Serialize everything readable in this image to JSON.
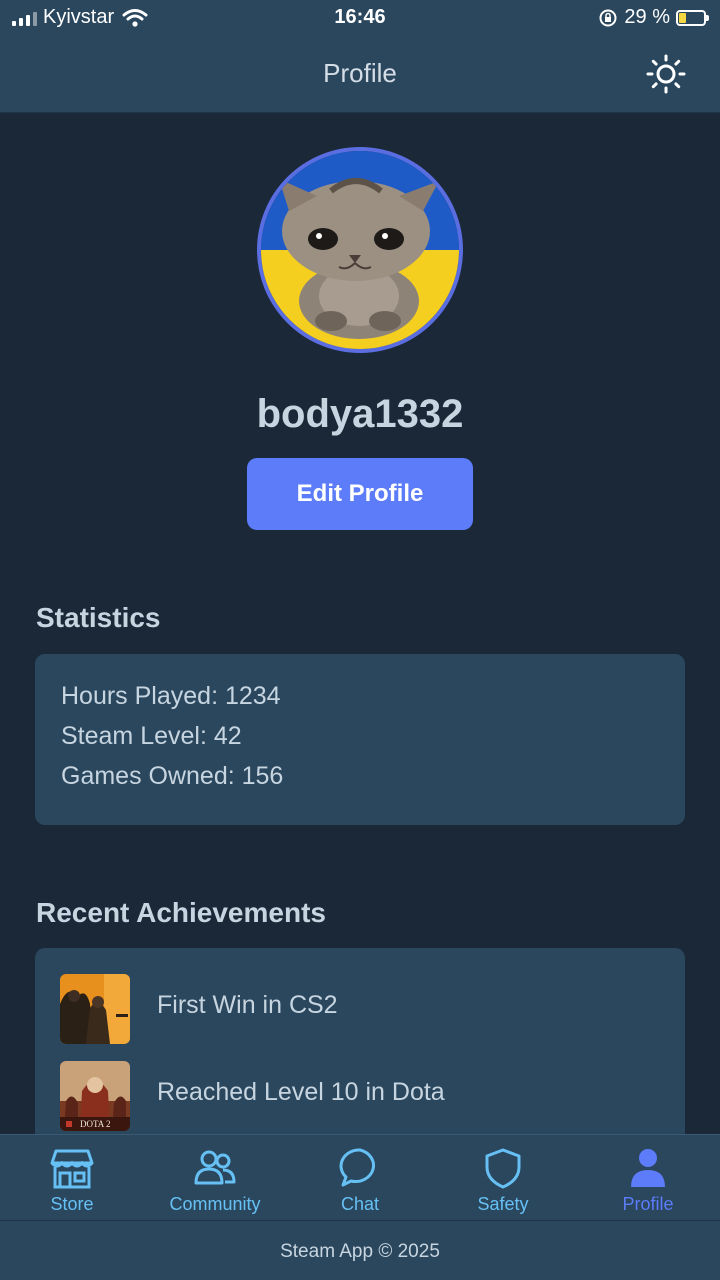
{
  "status_bar": {
    "carrier": "Kyivstar",
    "time": "16:46",
    "battery": "29 %",
    "battery_level": 0.29
  },
  "header": {
    "title": "Profile",
    "theme_icon": "sun-icon"
  },
  "profile": {
    "avatar_icon": "cat-avatar",
    "username": "bodya1332",
    "edit_label": "Edit Profile"
  },
  "statistics": {
    "title": "Statistics",
    "lines": [
      "Hours Played: 1234",
      "Steam Level: 42",
      "Games Owned: 156"
    ]
  },
  "achievements": {
    "title": "Recent Achievements",
    "items": [
      {
        "label": "First Win in CS2",
        "icon": "cs2-thumbnail"
      },
      {
        "label": "Reached Level 10 in Dota",
        "icon": "dota2-thumbnail",
        "thumb_text": "DOTA 2"
      }
    ]
  },
  "nav": {
    "items": [
      {
        "label": "Store",
        "icon": "store-icon"
      },
      {
        "label": "Community",
        "icon": "community-icon"
      },
      {
        "label": "Chat",
        "icon": "chat-icon"
      },
      {
        "label": "Safety",
        "icon": "shield-icon"
      },
      {
        "label": "Profile",
        "icon": "user-icon",
        "active": true
      }
    ]
  },
  "footer": {
    "text": "Steam App © 2025"
  },
  "colors": {
    "background": "#1b2838",
    "surface": "#2a475e",
    "accent": "#5c7cfa",
    "nav_icon": "#66c0f4",
    "text": "#c7d5e0"
  }
}
